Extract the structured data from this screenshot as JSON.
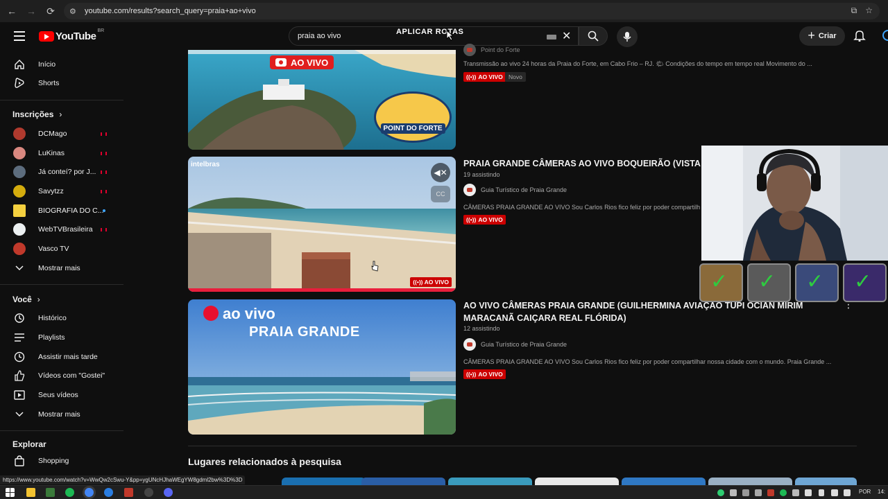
{
  "browser": {
    "url": "youtube.com/results?search_query=praia+ao+vivo",
    "status_url": "https://www.youtube.com/watch?v=WwQw2cSwu-Y&pp=ygUNcHJhaWEgYW8gdml2bw%3D%3D"
  },
  "header": {
    "logo_text": "YouTube",
    "logo_country": "BR",
    "search_query": "praia ao vivo",
    "overlay_text": "APLICAR ROTAS",
    "create_label": "Criar"
  },
  "sidebar": {
    "main": [
      {
        "label": "Início",
        "icon": "home-icon"
      },
      {
        "label": "Shorts",
        "icon": "shorts-icon"
      }
    ],
    "subscriptions_title": "Inscrições",
    "subscriptions": [
      {
        "label": "DCMago",
        "indicator": "live",
        "color": "#b03a2e"
      },
      {
        "label": "LuKinas",
        "indicator": "live",
        "color": "#d98880"
      },
      {
        "label": "Já conteí? por J...",
        "indicator": "live",
        "color": "#5d6d7e"
      },
      {
        "label": "Savytzz",
        "indicator": "live",
        "color": "#d4ac0d"
      },
      {
        "label": "BIOGRAFIA DO C...",
        "indicator": "new",
        "color": "#f4d03f"
      },
      {
        "label": "WebTVBrasileira",
        "indicator": "live",
        "color": "#ecf0f1"
      },
      {
        "label": "Vasco TV",
        "indicator": "none",
        "color": "#c0392b"
      }
    ],
    "show_more": "Mostrar mais",
    "you_title": "Você",
    "you": [
      {
        "label": "Histórico",
        "icon": "history-icon"
      },
      {
        "label": "Playlists",
        "icon": "playlists-icon"
      },
      {
        "label": "Assistir mais tarde",
        "icon": "watch-later-icon"
      },
      {
        "label": "Vídeos com \"Gostei\"",
        "icon": "like-icon"
      },
      {
        "label": "Seus vídeos",
        "icon": "your-videos-icon"
      }
    ],
    "show_more_2": "Mostrar mais",
    "explore_title": "Explorar",
    "explore": [
      {
        "label": "Shopping",
        "icon": "shopping-icon"
      }
    ]
  },
  "results": [
    {
      "thumb_text_1": "AO VIVO",
      "thumb_text_2": "POINT DO FORTE",
      "channel": "Point do Forte",
      "description": "Transmissão ao vivo 24 horas da Praia do Forte, em Cabo Frio – RJ. 🌤 Condições do tempo em tempo real Movimento do ...",
      "live_label": "AO VIVO",
      "new_label": "Novo"
    },
    {
      "title": "PRAIA GRANDE CÂMERAS AO VIVO BOQUEIRÃO (VISTA",
      "watching": "19 assistindo",
      "channel": "Guia Turístico de Praia Grande",
      "description": "CÂMERAS PRAIA GRANDE AO VIVO Sou Carlos Rios fico feliz por poder compartilh",
      "live_label": "AO VIVO",
      "thumb_brand": "intelbras",
      "thumb_live": "AO VIVO"
    },
    {
      "title_line1": "AO VIVO CÂMERAS PRAIA GRANDE (GUILHERMINA AVIAÇÃO TUPI OCIAN MIRIM",
      "title_line2": "MARACANÃ CAIÇARA REAL FLÓRIDA)",
      "watching": "12 assistindo",
      "channel": "Guia Turístico de Praia Grande",
      "description": "CÂMERAS PRAIA GRANDE AO VIVO Sou Carlos Rios fico feliz por poder compartilhar nossa cidade com o mundo. Praia Grande ...",
      "live_label": "AO VIVO",
      "thumb_text_1": "ao vivo",
      "thumb_text_2": "PRAIA GRANDE"
    }
  ],
  "related_heading": "Lugares relacionados à pesquisa",
  "taskbar": {
    "lang": "POR",
    "time": "14:"
  },
  "colors": {
    "live_red": "#cc0000",
    "accent_blue": "#3ea6ff",
    "check_green": "#2ecc40"
  }
}
